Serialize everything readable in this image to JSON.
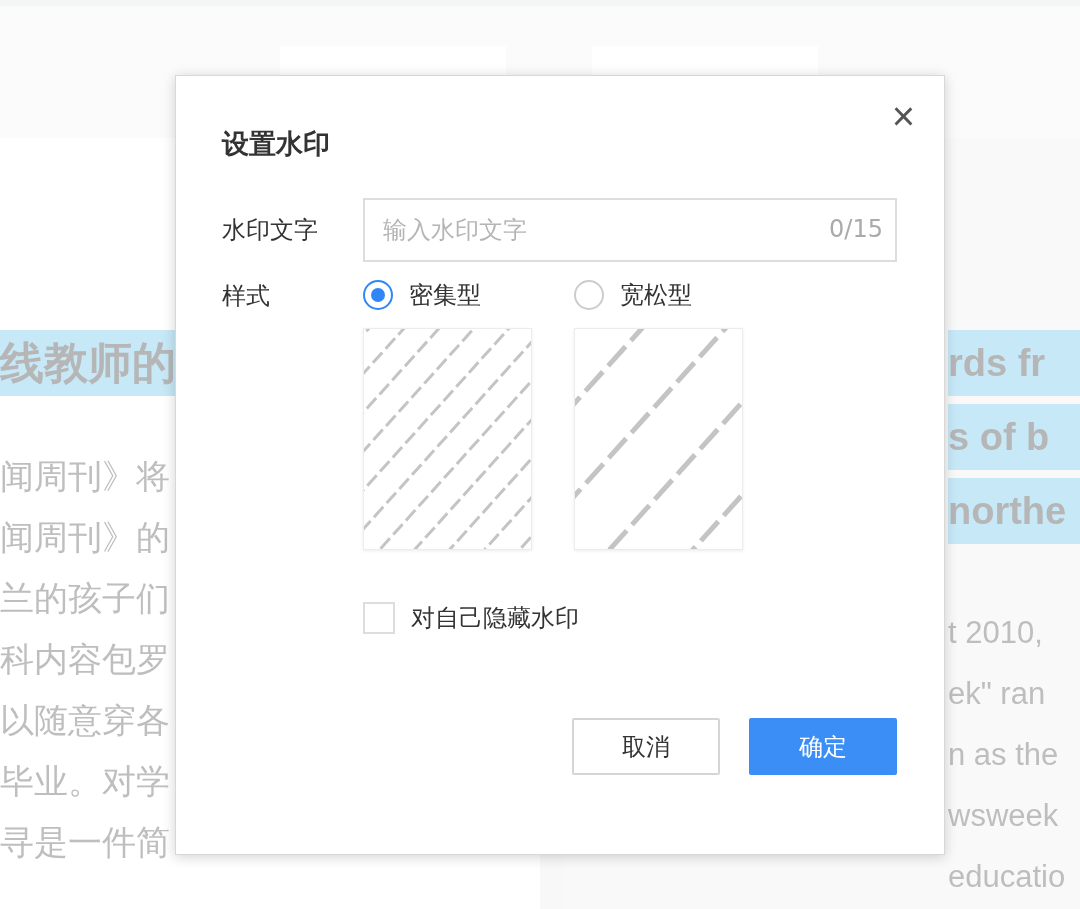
{
  "background": {
    "left_lines": [
      {
        "text": "线教师的",
        "kind": "heading"
      },
      {
        "text": "闻周刊》将",
        "kind": "body"
      },
      {
        "text": "闻周刊》的",
        "kind": "body"
      },
      {
        "text": "兰的孩子们",
        "kind": "body"
      },
      {
        "text": "科内容包罗",
        "kind": "body"
      },
      {
        "text": "以随意穿各",
        "kind": "body"
      },
      {
        "text": "毕业。对学",
        "kind": "body"
      },
      {
        "text": "寻是一件简",
        "kind": "body"
      }
    ],
    "right_lines": [
      {
        "text": "rds fr",
        "kind": "heading"
      },
      {
        "text": "s of b",
        "kind": "heading"
      },
      {
        "text": "northe",
        "kind": "heading"
      },
      {
        "text": "t 2010,",
        "kind": "body"
      },
      {
        "text": "ek\" ran",
        "kind": "body"
      },
      {
        "text": "n as the",
        "kind": "body"
      },
      {
        "text": "wsweek",
        "kind": "body"
      },
      {
        "text": "educatio",
        "kind": "body"
      }
    ]
  },
  "dialog": {
    "title": "设置水印",
    "close": "×",
    "text_field": {
      "label": "水印文字",
      "placeholder": "输入水印文字",
      "counter": "0/15"
    },
    "style": {
      "label": "样式",
      "options": [
        {
          "label": "密集型",
          "kind": "dense",
          "selected": true
        },
        {
          "label": "宽松型",
          "kind": "sparse",
          "selected": false
        }
      ]
    },
    "hide_for_self": {
      "label": "对自己隐藏水印",
      "checked": false
    },
    "buttons": [
      {
        "label": "取消",
        "kind": "secondary"
      },
      {
        "label": "确定",
        "kind": "primary"
      }
    ]
  }
}
